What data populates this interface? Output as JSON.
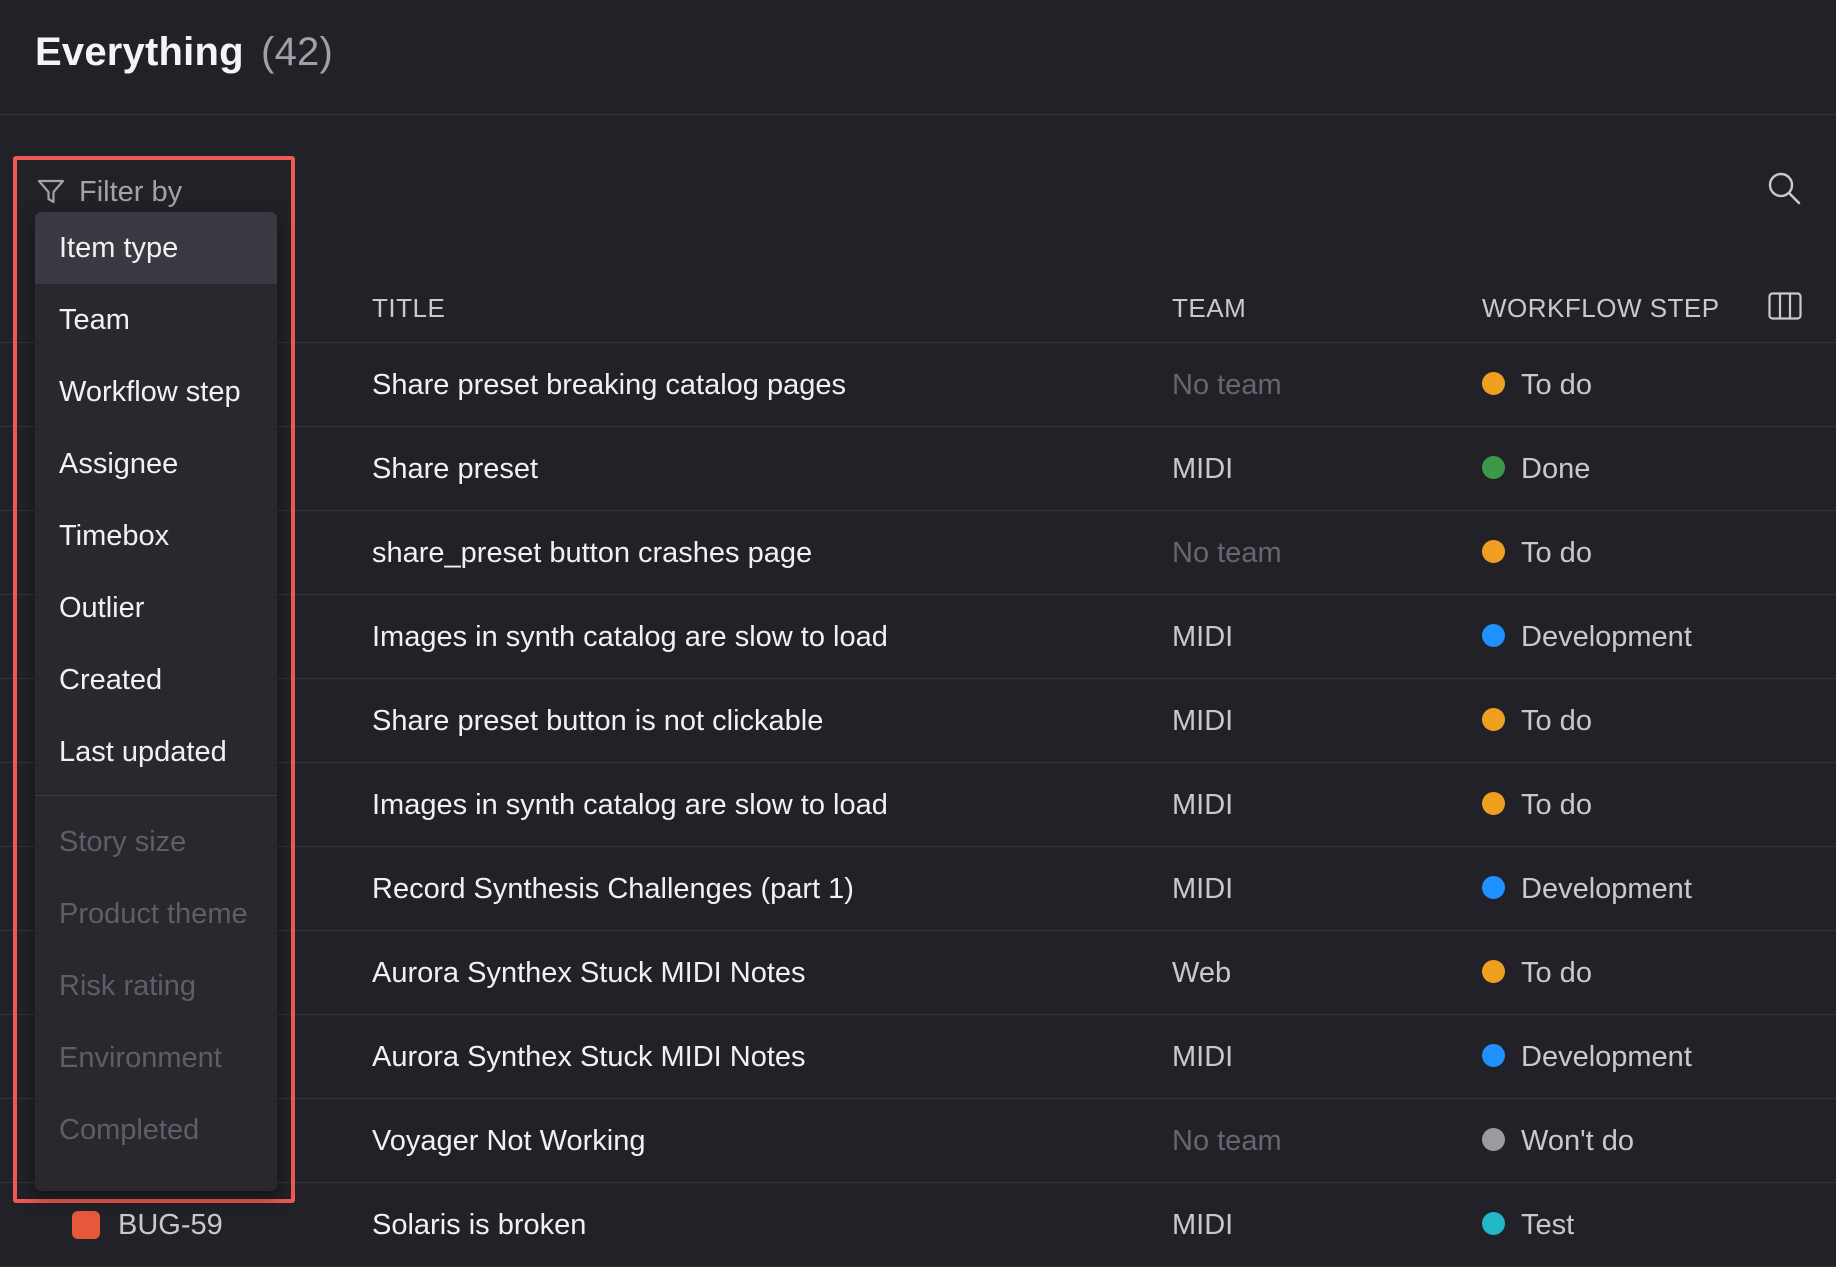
{
  "page": {
    "title": "Everything",
    "count": "(42)"
  },
  "filter": {
    "label": "Filter by",
    "items": [
      "Item type",
      "Team",
      "Workflow step",
      "Assignee",
      "Timebox",
      "Outlier",
      "Created",
      "Last updated"
    ],
    "disabled_items": [
      "Story size",
      "Product theme",
      "Risk rating",
      "Environment",
      "Completed"
    ],
    "active_item": "Item type"
  },
  "table": {
    "columns": {
      "title": "TITLE",
      "team": "TEAM",
      "workflow_step": "WORKFLOW STEP"
    },
    "rows": [
      {
        "id": "",
        "title": "Share preset breaking catalog pages",
        "team": "No team",
        "step": "To do",
        "step_color": "#f0a020"
      },
      {
        "id": "",
        "title": "Share preset",
        "team": "MIDI",
        "step": "Done",
        "step_color": "#3a9a4a"
      },
      {
        "id": "",
        "title": "share_preset button crashes page",
        "team": "No team",
        "step": "To do",
        "step_color": "#f0a020"
      },
      {
        "id": "",
        "title": "Images in synth catalog are slow to load",
        "team": "MIDI",
        "step": "Development",
        "step_color": "#1e90ff"
      },
      {
        "id": "",
        "title": "Share preset button is not clickable",
        "team": "MIDI",
        "step": "To do",
        "step_color": "#f0a020"
      },
      {
        "id": "",
        "title": "Images in synth catalog are slow to load",
        "team": "MIDI",
        "step": "To do",
        "step_color": "#f0a020"
      },
      {
        "id": "",
        "title": "Record Synthesis Challenges (part 1)",
        "team": "MIDI",
        "step": "Development",
        "step_color": "#1e90ff"
      },
      {
        "id": "",
        "title": "Aurora Synthex Stuck MIDI Notes",
        "team": "Web",
        "step": "To do",
        "step_color": "#f0a020"
      },
      {
        "id": "",
        "title": "Aurora Synthex Stuck MIDI Notes",
        "team": "MIDI",
        "step": "Development",
        "step_color": "#1e90ff"
      },
      {
        "id": "",
        "title": "Voyager Not Working",
        "team": "No team",
        "step": "Won't do",
        "step_color": "#9a9aa0"
      },
      {
        "id": "BUG-59",
        "title": "Solaris is broken",
        "team": "MIDI",
        "step": "Test",
        "step_color": "#22b8c8"
      }
    ]
  },
  "icons": {
    "filter": "filter-icon",
    "search": "search-icon",
    "columns": "columns-icon",
    "bug": "bug-icon"
  },
  "colors": {
    "highlight_border": "#ee5a4f"
  }
}
